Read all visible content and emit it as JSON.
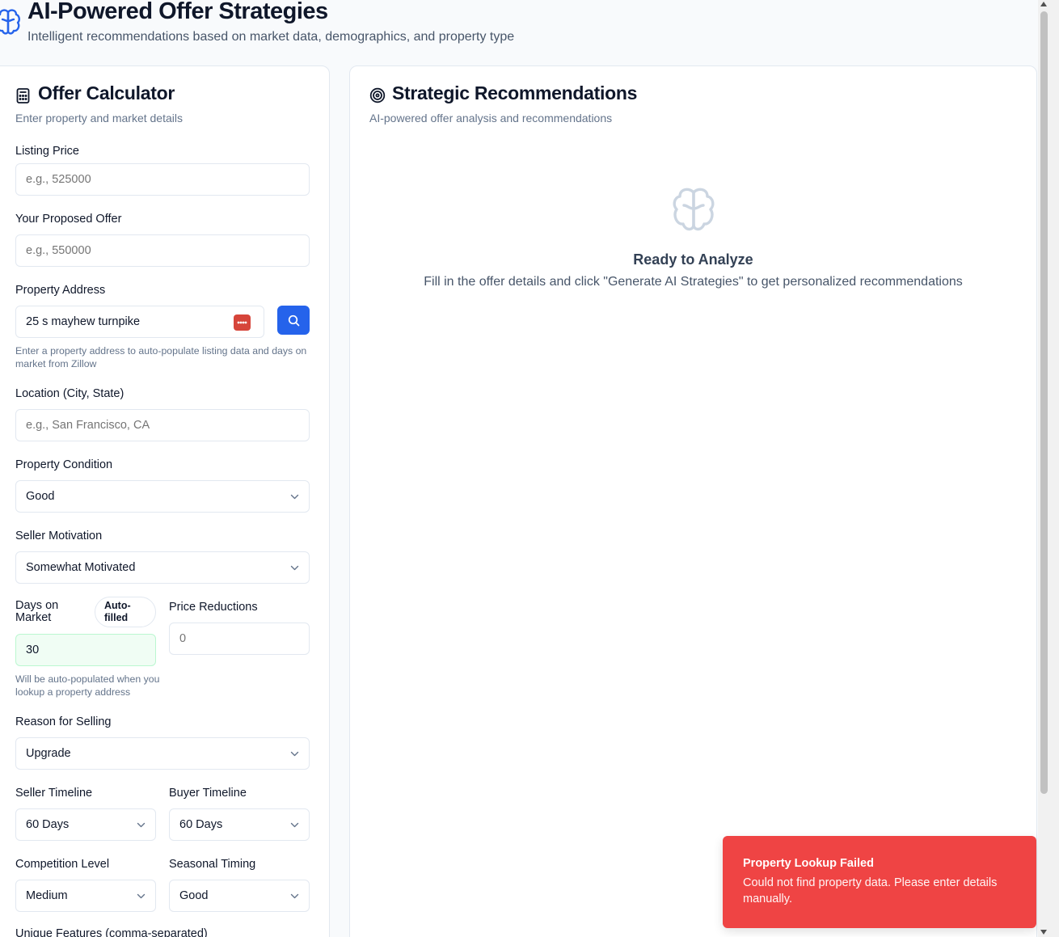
{
  "header": {
    "title": "AI-Powered Offer Strategies",
    "subtitle": "Intelligent recommendations based on market data, demographics, and property type",
    "icon": "brain-icon",
    "accent": "#2563eb"
  },
  "calculator": {
    "title": "Offer Calculator",
    "description": "Enter property and market details",
    "icon": "calculator-icon",
    "listing_price": {
      "label": "Listing Price",
      "placeholder": "e.g., 525000",
      "value": ""
    },
    "proposed_offer": {
      "label": "Your Proposed Offer",
      "placeholder": "e.g., 550000",
      "value": ""
    },
    "property_address": {
      "label": "Property Address",
      "value": "25 s mayhew turnpike",
      "help": "Enter a property address to auto-populate listing data and days on market from Zillow",
      "search_icon": "search-icon"
    },
    "location": {
      "label": "Location (City, State)",
      "placeholder": "e.g., San Francisco, CA",
      "value": ""
    },
    "property_condition": {
      "label": "Property Condition",
      "value": "Good"
    },
    "seller_motivation": {
      "label": "Seller Motivation",
      "value": "Somewhat Motivated"
    },
    "days_on_market": {
      "label": "Days on Market",
      "badge": "Auto-filled",
      "value": "30",
      "help": "Will be auto-populated when you lookup a property address"
    },
    "price_reductions": {
      "label": "Price Reductions",
      "placeholder": "0",
      "value": ""
    },
    "reason_for_selling": {
      "label": "Reason for Selling",
      "value": "Upgrade"
    },
    "seller_timeline": {
      "label": "Seller Timeline",
      "value": "60 Days"
    },
    "buyer_timeline": {
      "label": "Buyer Timeline",
      "value": "60 Days"
    },
    "competition_level": {
      "label": "Competition Level",
      "value": "Medium"
    },
    "seasonal_timing": {
      "label": "Seasonal Timing",
      "value": "Good"
    },
    "unique_features": {
      "label": "Unique Features (comma-separated)"
    }
  },
  "recommendations": {
    "title": "Strategic Recommendations",
    "description": "AI-powered offer analysis and recommendations",
    "icon": "target-icon",
    "empty_title": "Ready to Analyze",
    "empty_description": "Fill in the offer details and click \"Generate AI Strategies\" to get personalized recommendations"
  },
  "toast": {
    "title": "Property Lookup Failed",
    "description": "Could not find property data. Please enter details manually.",
    "color": "#ef4444"
  }
}
